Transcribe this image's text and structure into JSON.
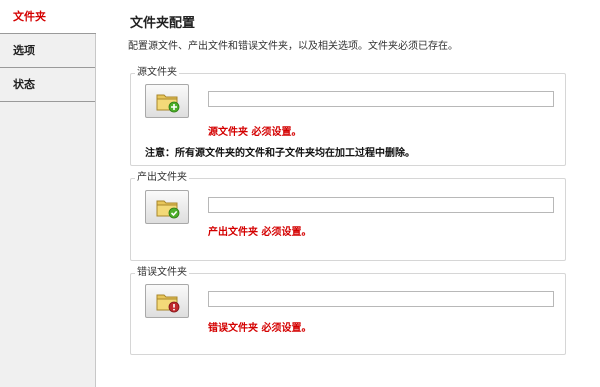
{
  "sidebar": {
    "items": [
      {
        "label": "文件夹"
      },
      {
        "label": "选项"
      },
      {
        "label": "状态"
      }
    ]
  },
  "page": {
    "title": "文件夹配置",
    "description": "配置源文件、产出文件和错误文件夹，以及相关选项。文件夹必须已存在。"
  },
  "source": {
    "label": "源文件夹",
    "value": "",
    "error": "源文件夹 必须设置。",
    "note": "注意：所有源文件夹的文件和子文件夹均在加工过程中删除。"
  },
  "output": {
    "label": "产出文件夹",
    "value": "",
    "error": "产出文件夹 必须设置。"
  },
  "errorFolder": {
    "label": "错误文件夹",
    "value": "",
    "error": "错误文件夹 必须设置。"
  },
  "colors": {
    "accent": "#d40000",
    "add_badge": "#4caf2a",
    "check_badge": "#4caf2a",
    "error_badge": "#c0282d"
  },
  "icons": [
    "folder-add-icon",
    "folder-check-icon",
    "folder-error-icon"
  ]
}
